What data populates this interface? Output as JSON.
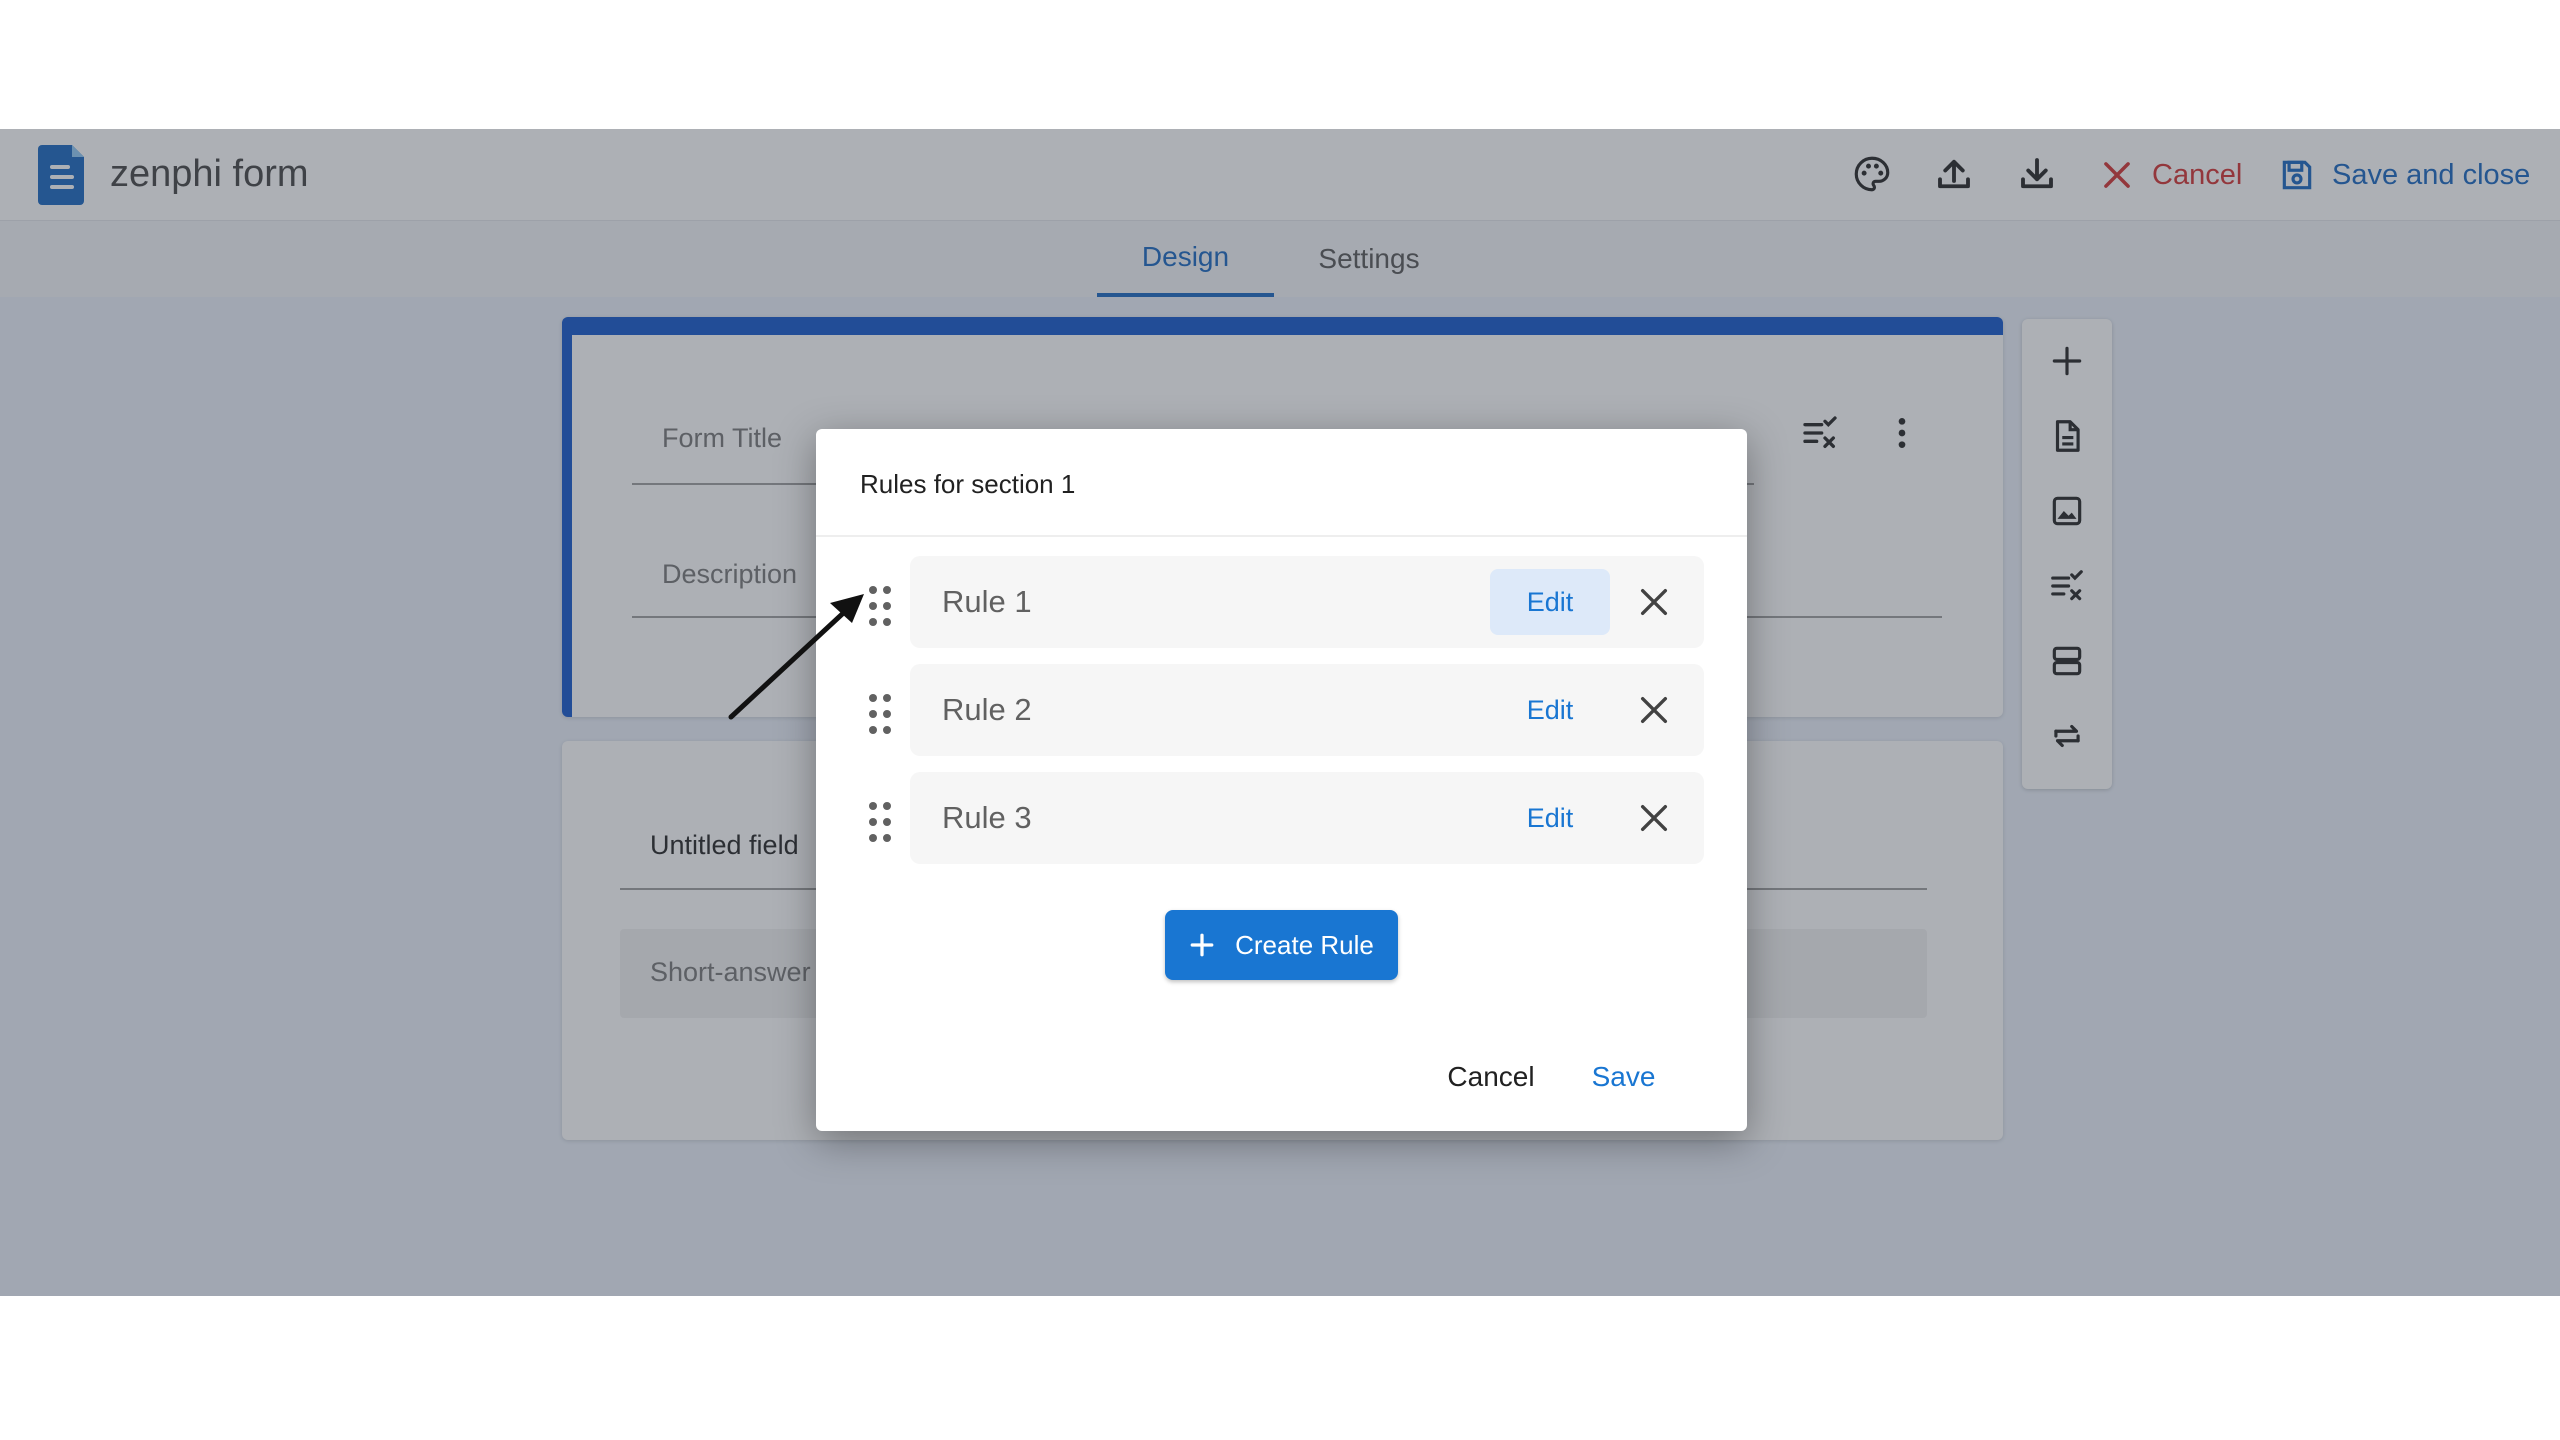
{
  "app": {
    "title": "zenphi form",
    "cancel_label": "Cancel",
    "save_close_label": "Save and close"
  },
  "tabs": [
    {
      "label": "Design",
      "active": true
    },
    {
      "label": "Settings",
      "active": false
    }
  ],
  "form": {
    "title_placeholder": "Form Title",
    "description_placeholder": "Description",
    "field_label": "Untitled field",
    "field_placeholder": "Short-answer text"
  },
  "dialog": {
    "title": "Rules for section 1",
    "rules": [
      {
        "label": "Rule 1",
        "edit_label": "Edit"
      },
      {
        "label": "Rule 2",
        "edit_label": "Edit"
      },
      {
        "label": "Rule 3",
        "edit_label": "Edit"
      }
    ],
    "create_label": "Create Rule",
    "cancel_label": "Cancel",
    "save_label": "Save"
  },
  "colors": {
    "primary": "#1976d2",
    "brand": "#1155cc",
    "danger": "#d32f2f"
  },
  "icons": {
    "logo": "document-logo-icon",
    "toolbar": [
      "palette-icon",
      "upload-icon",
      "download-icon"
    ],
    "side_rail": [
      "add-icon",
      "document-icon",
      "image-icon",
      "rules-icon",
      "section-icon",
      "repeat-icon"
    ]
  }
}
